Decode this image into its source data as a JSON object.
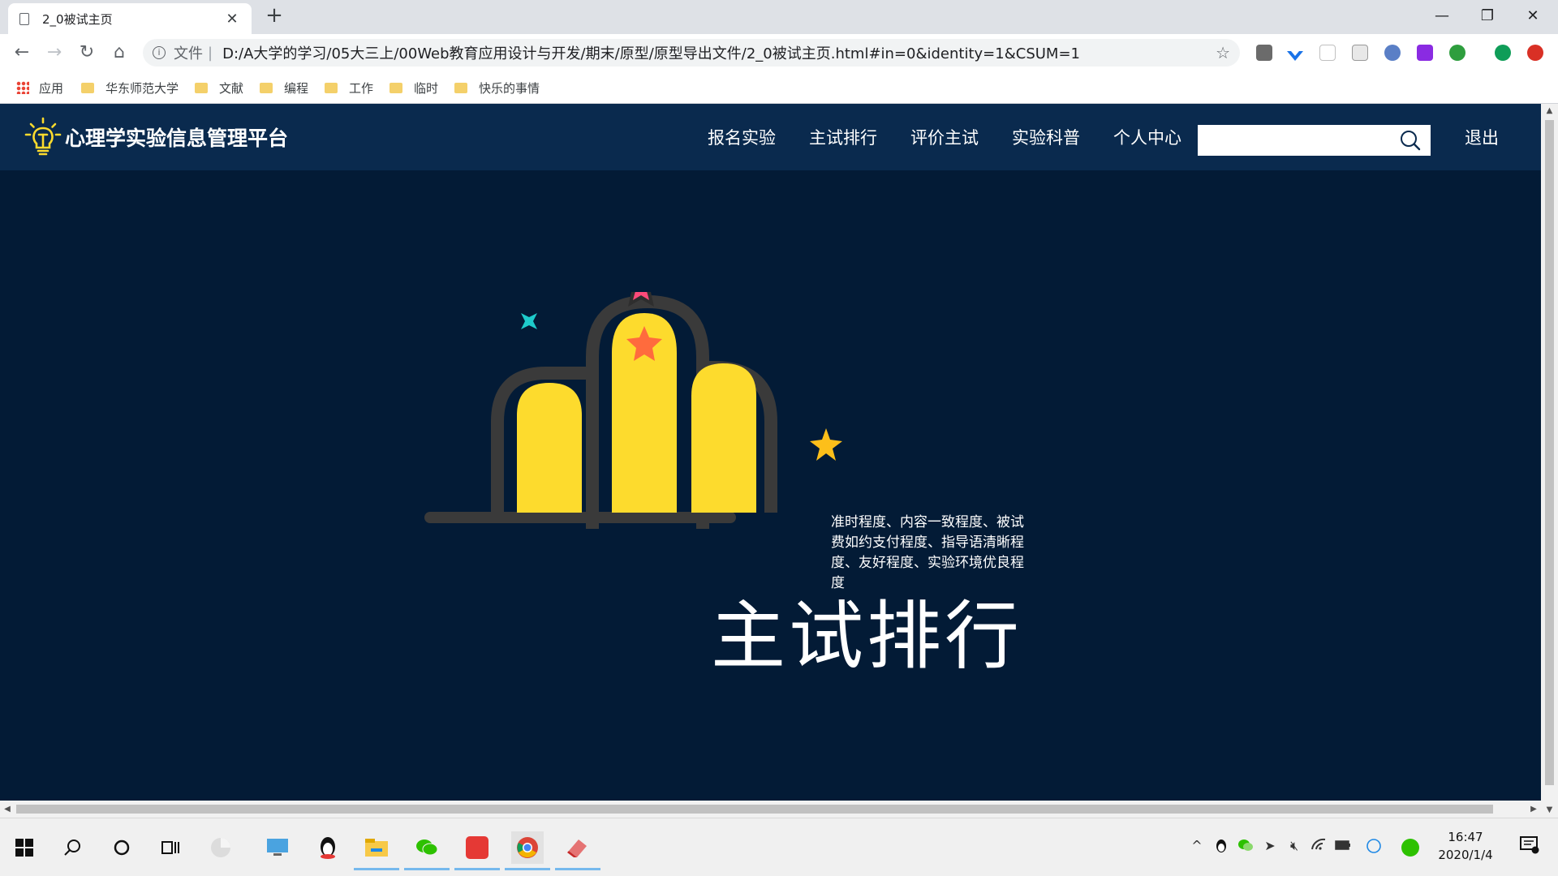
{
  "browser": {
    "tab_title": "2_0被试主页",
    "address_scheme": "文件",
    "address_url": "D:/A大学的学习/05大三上/00Web教育应用设计与开发/期末/原型/原型导出文件/2_0被试主页.html#in=0&identity=1&CSUM=1"
  },
  "bookmarks": [
    {
      "label": "应用",
      "icon": "apps-grid-icon"
    },
    {
      "label": "华东师范大学",
      "icon": "folder-icon"
    },
    {
      "label": "文献",
      "icon": "folder-icon"
    },
    {
      "label": "编程",
      "icon": "folder-icon"
    },
    {
      "label": "工作",
      "icon": "folder-icon"
    },
    {
      "label": "临时",
      "icon": "folder-icon"
    },
    {
      "label": "快乐的事情",
      "icon": "folder-icon"
    }
  ],
  "site": {
    "brand": "心理学实验信息管理平台",
    "nav": [
      "报名实验",
      "主试排行",
      "评价主试",
      "实验科普",
      "个人中心"
    ],
    "search_placeholder": "",
    "logout": "退出",
    "colors": {
      "header_bg": "#0a2a4e",
      "page_bg": "#031b36",
      "accent_yellow": "#fddb2d"
    }
  },
  "hero": {
    "title": "主试排行",
    "description": "准时程度、内容一致程度、被试费如约支付程度、指导语清晰程度、友好程度、实验环境优良程度"
  },
  "taskbar": {
    "clock_time": "16:47",
    "clock_date": "2020/1/4"
  }
}
